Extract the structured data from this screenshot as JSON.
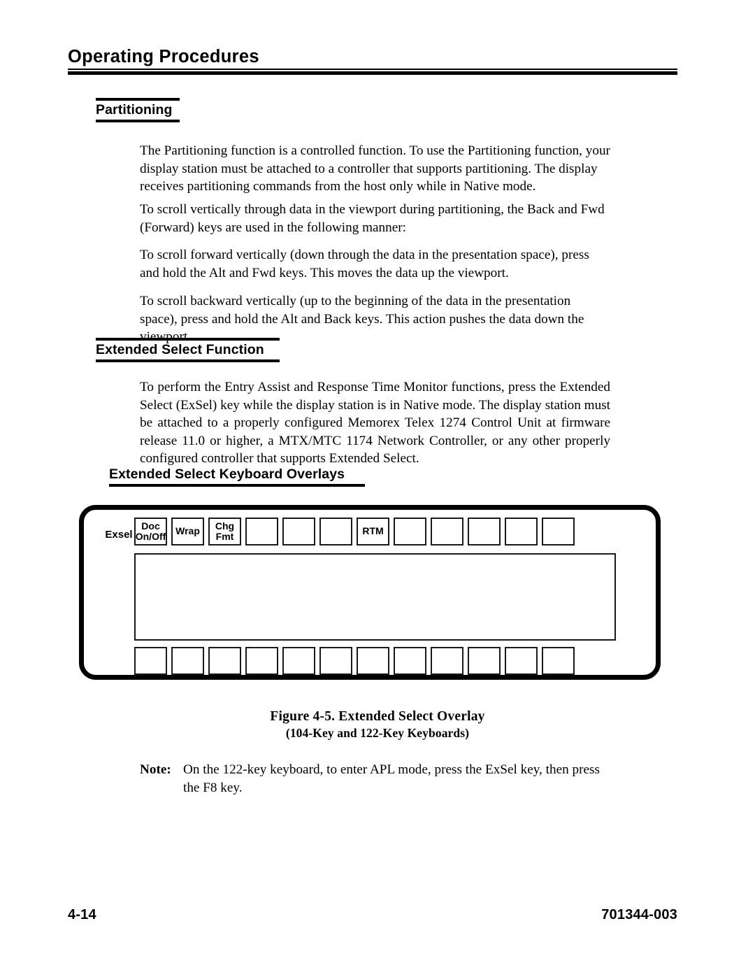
{
  "page": {
    "running_head": "Operating Procedures",
    "footer": {
      "page_number": "4-14",
      "document_number": "701344-003"
    }
  },
  "sections": [
    {
      "heading": "Partitioning",
      "paragraphs": [
        "The Partitioning function is a controlled function. To use the Partitioning function, your display station must be attached to a controller that supports partitioning. The display receives partitioning commands from the host only while in Native mode.",
        "To scroll vertically through data in the viewport during partitioning, the Back and Fwd (Forward) keys are used in the following manner:",
        "To scroll forward vertically (down through the data in the presentation space), press and hold the Alt and Fwd keys. This moves the data up the viewport.",
        "To scroll backward vertically (up to the beginning of the data in the presentation space), press and hold the Alt and Back keys. This action pushes the data down the viewport."
      ]
    },
    {
      "heading": "Extended Select Function",
      "paragraphs": [
        "To perform the Entry Assist and Response Time Monitor functions, press the Extended Select (ExSel) key while the display station is in Native mode. The display station must be attached to a properly configured Memorex Telex 1274 Control Unit at firmware release 11.0 or higher, a MTX/MTC 1174 Network Controller, or any other properly configured controller that supports Extended Select."
      ]
    },
    {
      "heading": "Extended Select Keyboard Overlays"
    }
  ],
  "figure": {
    "overlay": {
      "row_label": "Exsel",
      "top_keys": [
        {
          "line1": "Doc",
          "line2": "On/Off"
        },
        {
          "line1": "Wrap",
          "line2": ""
        },
        {
          "line1": "Chg",
          "line2": "Fmt"
        },
        {
          "line1": "",
          "line2": ""
        },
        {
          "line1": "",
          "line2": ""
        },
        {
          "line1": "",
          "line2": ""
        },
        {
          "line1": "RTM",
          "line2": ""
        },
        {
          "line1": "",
          "line2": ""
        },
        {
          "line1": "",
          "line2": ""
        },
        {
          "line1": "",
          "line2": ""
        },
        {
          "line1": "",
          "line2": ""
        },
        {
          "line1": "",
          "line2": ""
        }
      ],
      "bottom_keys": [
        {
          "line1": "",
          "line2": ""
        },
        {
          "line1": "",
          "line2": ""
        },
        {
          "line1": "",
          "line2": ""
        },
        {
          "line1": "",
          "line2": ""
        },
        {
          "line1": "",
          "line2": ""
        },
        {
          "line1": "",
          "line2": ""
        },
        {
          "line1": "",
          "line2": ""
        },
        {
          "line1": "",
          "line2": ""
        },
        {
          "line1": "",
          "line2": ""
        },
        {
          "line1": "",
          "line2": ""
        },
        {
          "line1": "",
          "line2": ""
        },
        {
          "line1": "",
          "line2": ""
        }
      ]
    },
    "caption_line1": "Figure 4-5.  Extended Select Overlay",
    "caption_line2": "(104-Key and 122-Key Keyboards)"
  },
  "note": {
    "label": "Note:",
    "text": "On the 122-key keyboard, to enter APL mode, press the ExSel key, then press the F8 key."
  }
}
